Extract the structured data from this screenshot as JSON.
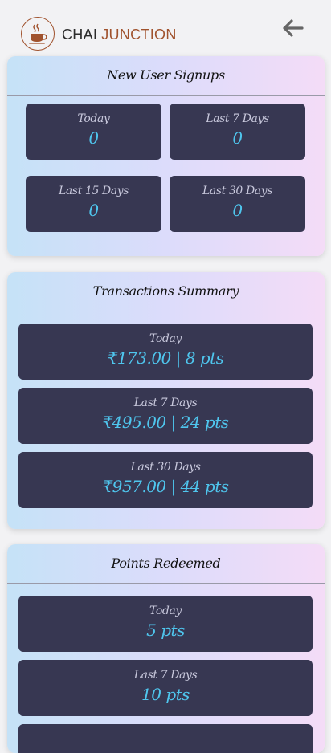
{
  "brand": {
    "part1": "CHAI",
    "part2": "JUNCTION"
  },
  "signups": {
    "title": "New User Signups",
    "items": [
      {
        "label": "Today",
        "value": "0"
      },
      {
        "label": "Last 7 Days",
        "value": "0"
      },
      {
        "label": "Last 15 Days",
        "value": "0"
      },
      {
        "label": "Last 30 Days",
        "value": "0"
      }
    ]
  },
  "transactions": {
    "title": "Transactions Summary",
    "items": [
      {
        "label": "Today",
        "value": "₹173.00 | 8 pts"
      },
      {
        "label": "Last 7 Days",
        "value": "₹495.00 | 24 pts"
      },
      {
        "label": "Last 30 Days",
        "value": "₹957.00 | 44 pts"
      }
    ]
  },
  "redeemed": {
    "title": "Points Redeemed",
    "items": [
      {
        "label": "Today",
        "value": "5 pts"
      },
      {
        "label": "Last 7 Days",
        "value": "10 pts"
      }
    ]
  },
  "colors": {
    "brand_accent": "#a0522d",
    "tile_bg": "#373752",
    "value_text": "#4fc6ee"
  },
  "icons": {
    "logo": "tea-cup-icon",
    "back": "arrow-left-icon"
  }
}
